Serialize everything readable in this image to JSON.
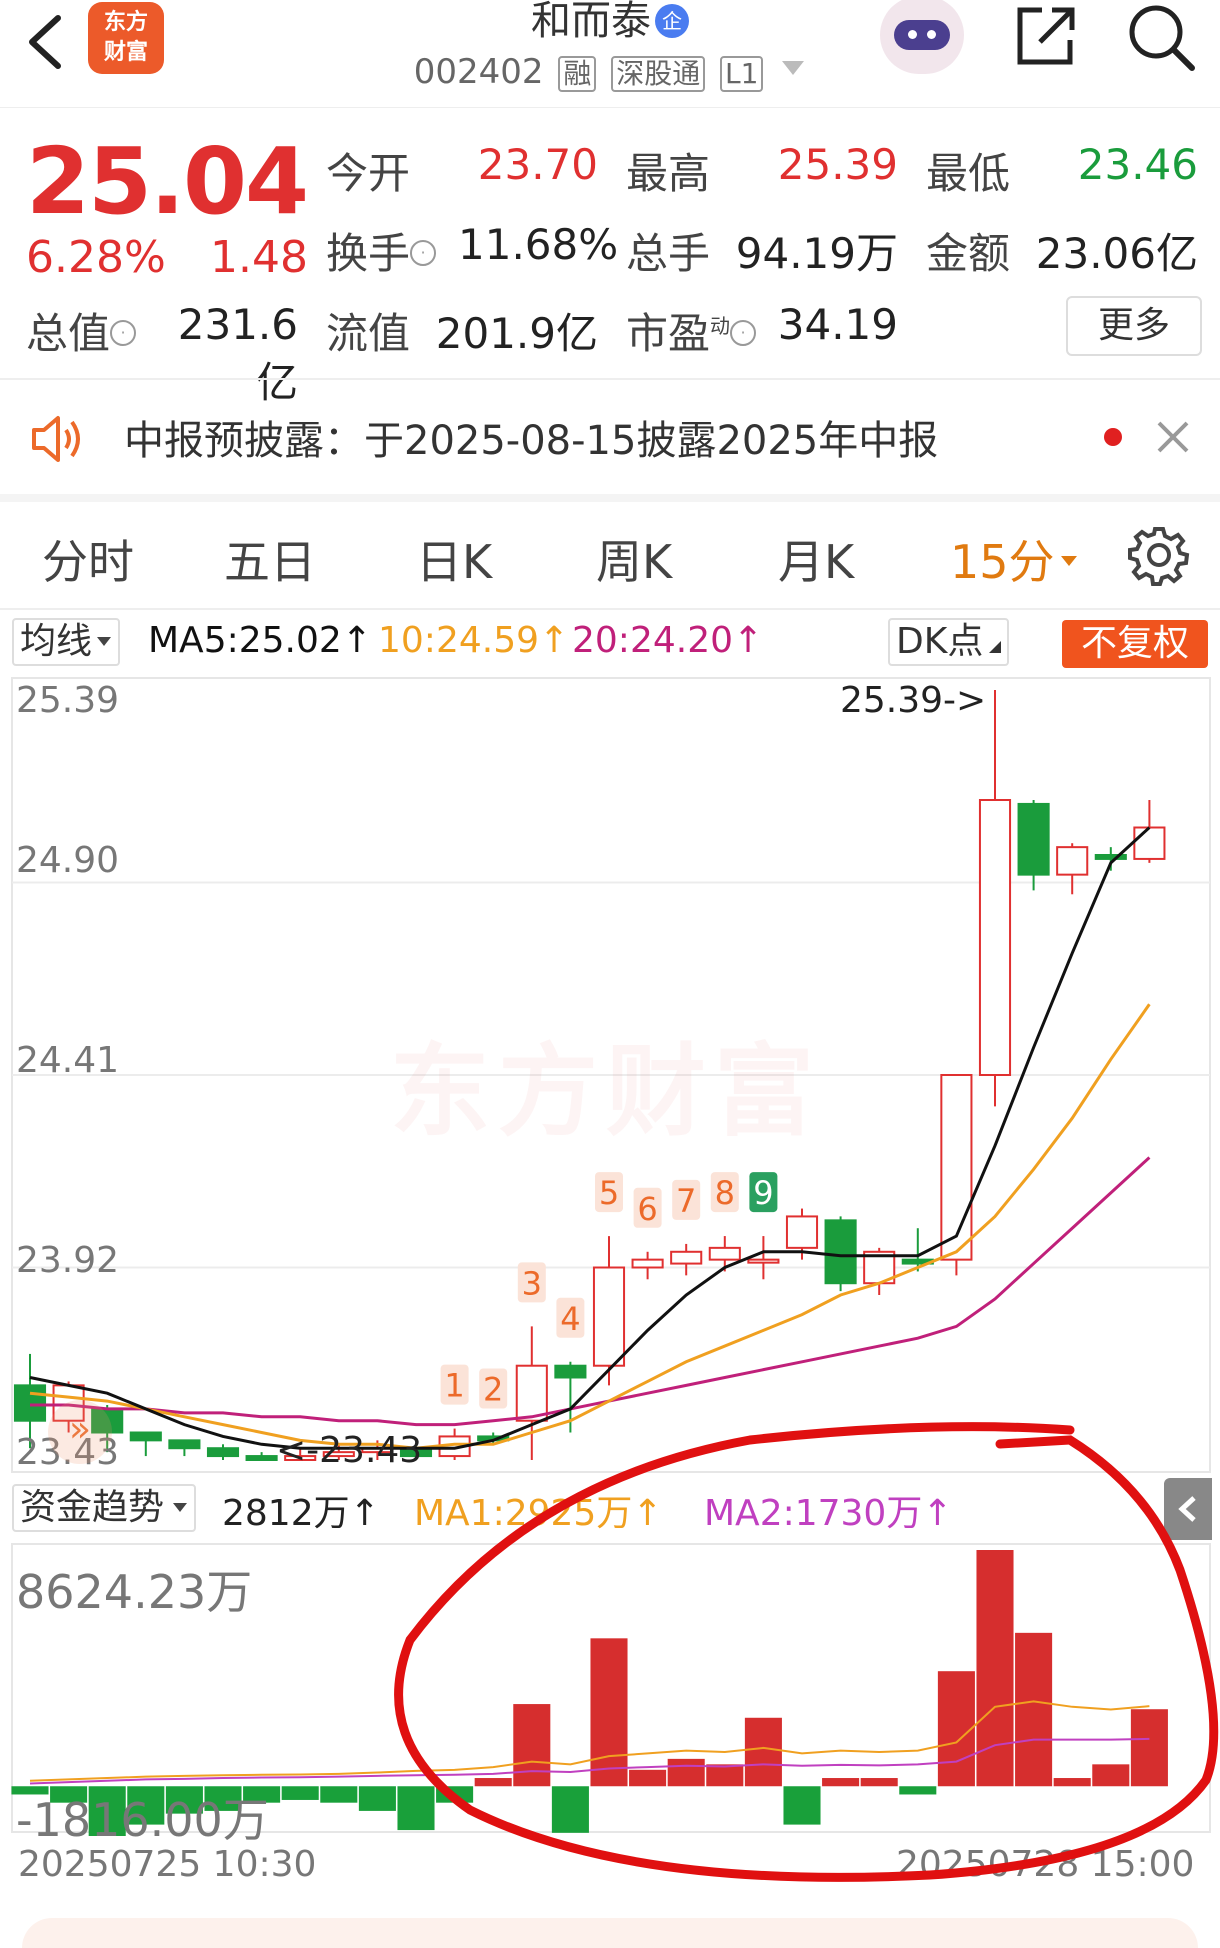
{
  "header": {
    "logo_text_line1": "东方",
    "logo_text_line2": "财富",
    "stock_name": "和而泰",
    "enterprise_badge": "企",
    "stock_code": "002402",
    "tags": [
      "融",
      "深股通",
      "L1"
    ],
    "icons": [
      "back-icon",
      "robot-icon",
      "share-icon",
      "search-icon",
      "dropdown-caret-icon"
    ]
  },
  "quote": {
    "price": "25.04",
    "change_pct": "6.28%",
    "change_amt": "1.48",
    "open_label": "今开",
    "open": "23.70",
    "high_label": "最高",
    "high": "25.39",
    "low_label": "最低",
    "low": "23.46",
    "turnover_label": "换手",
    "turnover": "11.68%",
    "volume_label": "总手",
    "volume": "94.19万",
    "amount_label": "金额",
    "amount": "23.06亿",
    "mktcap_label": "总值",
    "mktcap": "231.6亿",
    "float_label": "流值",
    "float_cap": "201.9亿",
    "pe_label": "市盈",
    "pe_sup": "动",
    "pe": "34.19",
    "more_label": "更多"
  },
  "notice": {
    "text": "中报预披露：于2025-08-15披露2025年中报"
  },
  "tabs": [
    {
      "label": "分时",
      "active": false
    },
    {
      "label": "五日",
      "active": false
    },
    {
      "label": "日K",
      "active": false
    },
    {
      "label": "周K",
      "active": false
    },
    {
      "label": "月K",
      "active": false
    },
    {
      "label": "15分",
      "active": true
    }
  ],
  "chart_legend": {
    "ma_selector": "均线",
    "ma5": "MA5:25.02↑",
    "ma10": "10:24.59↑",
    "ma20": "20:24.20↑",
    "dk_label": "DK点",
    "fq_label": "不复权",
    "ma5_color": "#111111",
    "ma10_color": "#f0a020",
    "ma20_color": "#c0207a"
  },
  "price_axis": [
    "25.39",
    "24.90",
    "24.41",
    "23.92",
    "23.43"
  ],
  "high_marker": "25.39->",
  "low_marker": "<-23.43",
  "watermark": "东方财富",
  "td_labels": [
    "1",
    "2",
    "3",
    "4",
    "5",
    "6",
    "7",
    "8",
    "9"
  ],
  "fund_legend": {
    "selector": "资金趋势",
    "value": "2812万↑",
    "ma1": "MA1:2925万↑",
    "ma2": "MA2:1730万↑",
    "ma1_color": "#f0a020",
    "ma2_color": "#c040c0"
  },
  "fund_axis": {
    "top": "8624.23万",
    "bottom": "-1816.00万"
  },
  "time_axis": {
    "start": "20250725 10:30",
    "end": "20250728 15:00"
  },
  "chart_data": [
    {
      "type": "candlestick",
      "title": "",
      "interval": "15分",
      "ylim": [
        23.43,
        25.39
      ],
      "candles": [
        {
          "o": 23.62,
          "c": 23.53,
          "h": 23.7,
          "l": 23.46
        },
        {
          "o": 23.53,
          "c": 23.62,
          "h": 23.63,
          "l": 23.5
        },
        {
          "o": 23.56,
          "c": 23.5,
          "h": 23.57,
          "l": 23.45
        },
        {
          "o": 23.5,
          "c": 23.48,
          "h": 23.5,
          "l": 23.44
        },
        {
          "o": 23.48,
          "c": 23.46,
          "h": 23.48,
          "l": 23.44
        },
        {
          "o": 23.46,
          "c": 23.44,
          "h": 23.47,
          "l": 23.43
        },
        {
          "o": 23.44,
          "c": 23.43,
          "h": 23.45,
          "l": 23.43
        },
        {
          "o": 23.43,
          "c": 23.44,
          "h": 23.46,
          "l": 23.43
        },
        {
          "o": 23.44,
          "c": 23.45,
          "h": 23.47,
          "l": 23.43
        },
        {
          "o": 23.45,
          "c": 23.46,
          "h": 23.48,
          "l": 23.43
        },
        {
          "o": 23.46,
          "c": 23.44,
          "h": 23.47,
          "l": 23.43
        },
        {
          "o": 23.44,
          "c": 23.49,
          "h": 23.51,
          "l": 23.43
        },
        {
          "o": 23.49,
          "c": 23.48,
          "h": 23.5,
          "l": 23.47
        },
        {
          "o": 23.53,
          "c": 23.67,
          "h": 23.77,
          "l": 23.43
        },
        {
          "o": 23.67,
          "c": 23.64,
          "h": 23.68,
          "l": 23.5
        },
        {
          "o": 23.67,
          "c": 23.92,
          "h": 24.0,
          "l": 23.62
        },
        {
          "o": 23.92,
          "c": 23.94,
          "h": 23.96,
          "l": 23.89
        },
        {
          "o": 23.93,
          "c": 23.96,
          "h": 23.98,
          "l": 23.9
        },
        {
          "o": 23.94,
          "c": 23.97,
          "h": 24.0,
          "l": 23.91
        },
        {
          "o": 23.94,
          "c": 23.94,
          "h": 24.0,
          "l": 23.89
        },
        {
          "o": 23.97,
          "c": 24.05,
          "h": 24.07,
          "l": 23.94
        },
        {
          "o": 24.04,
          "c": 23.88,
          "h": 24.05,
          "l": 23.86
        },
        {
          "o": 23.88,
          "c": 23.96,
          "h": 23.97,
          "l": 23.85
        },
        {
          "o": 23.94,
          "c": 23.93,
          "h": 24.02,
          "l": 23.91
        },
        {
          "o": 23.94,
          "c": 24.41,
          "h": 24.41,
          "l": 23.9
        },
        {
          "o": 24.41,
          "c": 25.11,
          "h": 25.39,
          "l": 24.33
        },
        {
          "o": 25.1,
          "c": 24.92,
          "h": 25.11,
          "l": 24.88
        },
        {
          "o": 24.92,
          "c": 24.99,
          "h": 25.0,
          "l": 24.87
        },
        {
          "o": 24.97,
          "c": 24.96,
          "h": 24.99,
          "l": 24.93
        },
        {
          "o": 24.96,
          "c": 25.04,
          "h": 25.11,
          "l": 24.95
        }
      ],
      "ma5": [
        23.64,
        23.62,
        23.6,
        23.56,
        23.52,
        23.49,
        23.47,
        23.46,
        23.46,
        23.46,
        23.46,
        23.46,
        23.48,
        23.52,
        23.56,
        23.66,
        23.76,
        23.85,
        23.92,
        23.96,
        23.96,
        23.95,
        23.95,
        23.95,
        24.0,
        24.23,
        24.48,
        24.72,
        24.95,
        25.04
      ],
      "ma10": [
        23.6,
        23.59,
        23.58,
        23.56,
        23.54,
        23.52,
        23.5,
        23.48,
        23.47,
        23.47,
        23.46,
        23.47,
        23.47,
        23.5,
        23.53,
        23.58,
        23.63,
        23.68,
        23.72,
        23.76,
        23.8,
        23.85,
        23.88,
        23.92,
        23.96,
        24.05,
        24.17,
        24.3,
        24.45,
        24.59
      ],
      "ma20": [
        23.57,
        23.57,
        23.56,
        23.56,
        23.55,
        23.55,
        23.54,
        23.54,
        23.53,
        23.53,
        23.52,
        23.52,
        23.53,
        23.54,
        23.56,
        23.58,
        23.6,
        23.62,
        23.64,
        23.66,
        23.68,
        23.7,
        23.72,
        23.74,
        23.77,
        23.84,
        23.93,
        24.02,
        24.11,
        24.2
      ]
    },
    {
      "type": "bar",
      "title": "",
      "series_label": "资金趋势",
      "unit": "万",
      "ylim": [
        -1816,
        8624.23
      ],
      "values": [
        -300,
        -600,
        -1816,
        -1400,
        -1000,
        -900,
        -600,
        -500,
        -600,
        -900,
        -1600,
        -600,
        300,
        3000,
        -1700,
        5400,
        600,
        1000,
        800,
        2500,
        -1400,
        300,
        300,
        -300,
        4200,
        8624,
        5600,
        300,
        800,
        2812
      ],
      "ma1": [
        200,
        250,
        300,
        350,
        380,
        400,
        420,
        430,
        450,
        500,
        560,
        600,
        700,
        900,
        800,
        1100,
        1200,
        1300,
        1250,
        1400,
        1200,
        1300,
        1250,
        1300,
        1600,
        2900,
        3100,
        2900,
        2800,
        2925
      ],
      "ma2": [
        100,
        150,
        200,
        250,
        270,
        300,
        320,
        330,
        350,
        380,
        400,
        420,
        450,
        550,
        520,
        650,
        700,
        750,
        720,
        800,
        750,
        780,
        760,
        800,
        900,
        1500,
        1700,
        1700,
        1700,
        1730
      ]
    }
  ]
}
